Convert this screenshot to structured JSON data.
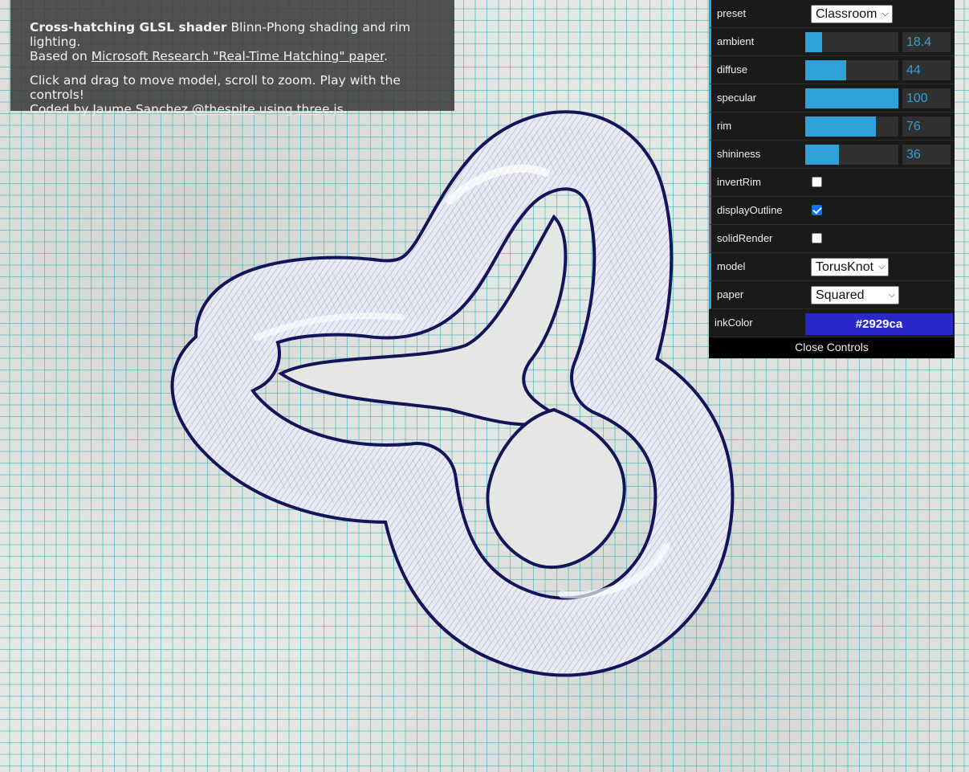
{
  "info": {
    "title": "Cross-hatching GLSL shader",
    "title_rest": " Blinn-Phong shading and rim lighting.",
    "based_on": "Based on ",
    "paper_link": "Microsoft Research \"Real-Time Hatching\" paper",
    "period": ".",
    "instructions": "Click and drag to move model, scroll to zoom. Play with the controls!",
    "credit_prefix": "Coded by Jaume Sanchez ",
    "author_link": "@thespite",
    "credit_middle": " using ",
    "lib_link": "three.js",
    "credit_end": "."
  },
  "controls": {
    "preset": {
      "label": "preset",
      "value": "Classroom"
    },
    "ambient": {
      "label": "ambient",
      "value": "18.4",
      "fraction": 0.184
    },
    "diffuse": {
      "label": "diffuse",
      "value": "44",
      "fraction": 0.44
    },
    "specular": {
      "label": "specular",
      "value": "100",
      "fraction": 1.0
    },
    "rim": {
      "label": "rim",
      "value": "76",
      "fraction": 0.76
    },
    "shininess": {
      "label": "shininess",
      "value": "36",
      "fraction": 0.36
    },
    "invertRim": {
      "label": "invertRim",
      "checked": false
    },
    "displayOutline": {
      "label": "displayOutline",
      "checked": true
    },
    "solidRender": {
      "label": "solidRender",
      "checked": false
    },
    "model": {
      "label": "model",
      "value": "TorusKnot"
    },
    "paper": {
      "label": "paper",
      "value": "Squared"
    },
    "inkColor": {
      "label": "inkColor",
      "value": "#2929ca"
    },
    "close": "Close Controls"
  },
  "colors": {
    "accent": "#2fa1d6",
    "ink": "#2929ca",
    "outline": "#14145a",
    "grid": "#28aaaf"
  },
  "icons": {
    "dropdown": "chevron-down-icon",
    "checkbox": "check-icon"
  }
}
